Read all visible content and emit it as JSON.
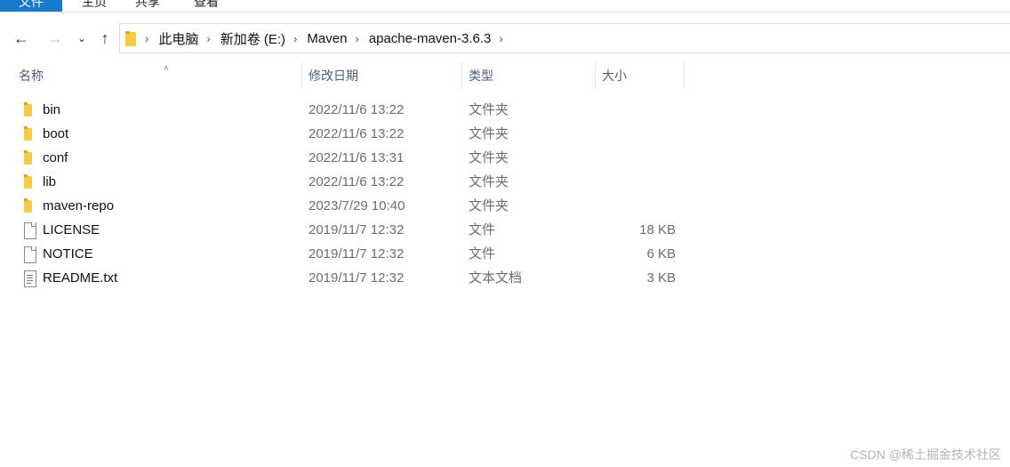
{
  "ribbon": {
    "tabs": [
      "文件",
      "主页",
      "共享",
      "查看"
    ]
  },
  "navigation": {
    "back_icon": "arrow-left-icon",
    "forward_icon": "arrow-right-icon",
    "recent_icon": "chevron-down-icon",
    "up_icon": "arrow-up-icon"
  },
  "breadcrumb": {
    "items": [
      "此电脑",
      "新加卷 (E:)",
      "Maven",
      "apache-maven-3.6.3"
    ]
  },
  "columns": {
    "name": "名称",
    "modified": "修改日期",
    "type": "类型",
    "size": "大小"
  },
  "files": [
    {
      "icon": "folder-icon",
      "name": "bin",
      "modified": "2022/11/6 13:22",
      "type": "文件夹",
      "size": ""
    },
    {
      "icon": "folder-icon",
      "name": "boot",
      "modified": "2022/11/6 13:22",
      "type": "文件夹",
      "size": ""
    },
    {
      "icon": "folder-icon",
      "name": "conf",
      "modified": "2022/11/6 13:31",
      "type": "文件夹",
      "size": ""
    },
    {
      "icon": "folder-icon",
      "name": "lib",
      "modified": "2022/11/6 13:22",
      "type": "文件夹",
      "size": ""
    },
    {
      "icon": "folder-icon",
      "name": "maven-repo",
      "modified": "2023/7/29 10:40",
      "type": "文件夹",
      "size": ""
    },
    {
      "icon": "file-icon",
      "name": "LICENSE",
      "modified": "2019/11/7 12:32",
      "type": "文件",
      "size": "18 KB"
    },
    {
      "icon": "file-icon",
      "name": "NOTICE",
      "modified": "2019/11/7 12:32",
      "type": "文件",
      "size": "6 KB"
    },
    {
      "icon": "text-file-icon",
      "name": "README.txt",
      "modified": "2019/11/7 12:32",
      "type": "文本文档",
      "size": "3 KB"
    }
  ],
  "watermark": "CSDN @稀土掘金技术社区",
  "colors": {
    "file_tab": "#1979ca",
    "folder": "#f6cb47",
    "header_text": "#4c607a",
    "secondary_text": "#6d6d6d"
  }
}
